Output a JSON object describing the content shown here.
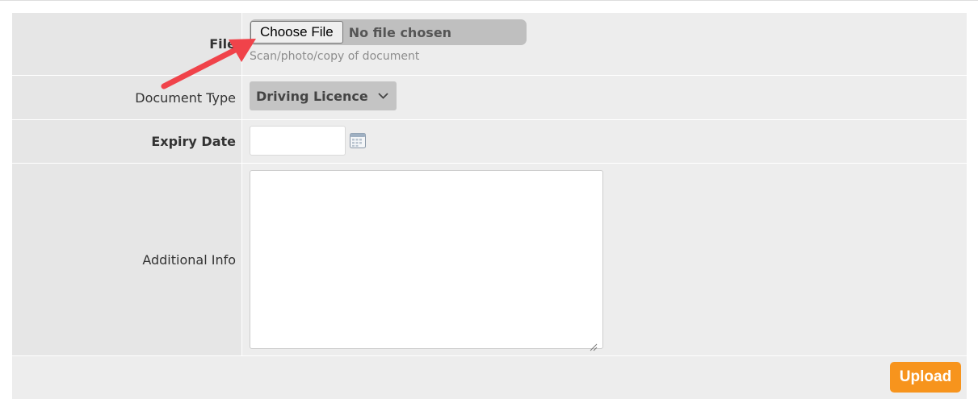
{
  "form": {
    "file": {
      "label": "File",
      "choose_button": "Choose File",
      "status": "No file chosen",
      "help": "Scan/photo/copy of document"
    },
    "document_type": {
      "label": "Document Type",
      "selected": "Driving Licence"
    },
    "expiry_date": {
      "label": "Expiry Date",
      "value": ""
    },
    "additional_info": {
      "label": "Additional Info",
      "value": ""
    },
    "upload_button": "Upload"
  },
  "colors": {
    "accent": "#f7941d",
    "annotation_arrow": "#f0434a"
  },
  "icons": {
    "calendar": "calendar-icon",
    "select_chevron": "chevron-down-icon",
    "annotation": "arrow-annotation-icon"
  }
}
